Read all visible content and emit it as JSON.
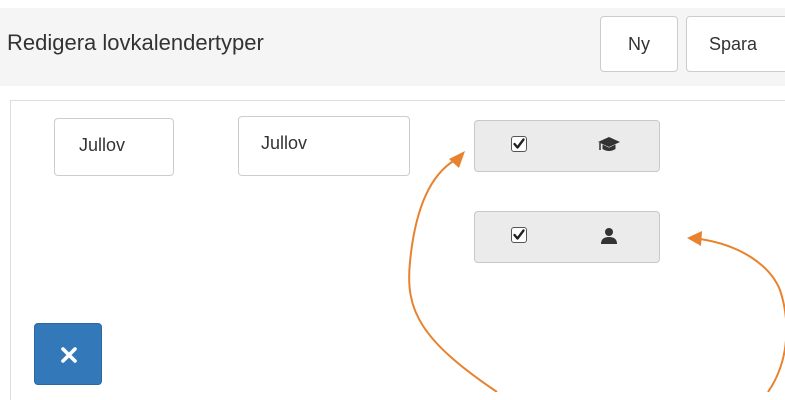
{
  "header": {
    "title": "Redigera lovkalendertyper",
    "new_label": "Ny",
    "save_label": "Spara"
  },
  "row": {
    "abbreviation": "Jullov",
    "name": "Jullov",
    "roles": [
      {
        "role": "student",
        "icon": "graduation-cap-icon",
        "checked": true
      },
      {
        "role": "staff",
        "icon": "user-icon",
        "checked": true
      }
    ],
    "delete_icon": "close-icon"
  },
  "annotation": {
    "arrow_color": "#e8822e"
  },
  "colors": {
    "header_bg": "#f5f5f5",
    "delete_button": "#3378b9",
    "toggle_bg": "#ebebeb"
  }
}
